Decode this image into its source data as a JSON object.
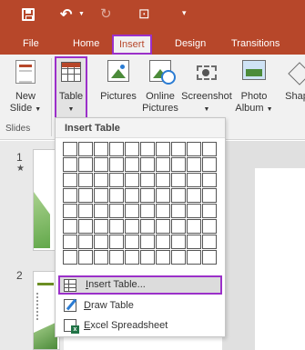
{
  "tabs": {
    "file": "File",
    "home": "Home",
    "insert": "Insert",
    "design": "Design",
    "transitions": "Transitions"
  },
  "ribbon": {
    "new_slide": [
      "New",
      "Slide"
    ],
    "table": "Table",
    "pictures": "Pictures",
    "online_pictures": [
      "Online",
      "Pictures"
    ],
    "screenshot": "Screenshot",
    "photo_album": [
      "Photo",
      "Album"
    ],
    "shapes": "Shap",
    "group_slides": "Slides"
  },
  "slides": {
    "numbers": [
      "1",
      "2"
    ],
    "star": "★"
  },
  "dropdown": {
    "header": "Insert Table",
    "grid": {
      "columns": 10,
      "rows": 8
    },
    "items": {
      "insert_table_accel": "I",
      "insert_table_rest": "nsert Table...",
      "draw_table_accel": "D",
      "draw_table_rest": "raw Table",
      "excel_accel": "E",
      "excel_rest": "xcel Spreadsheet"
    }
  },
  "colors": {
    "brand": "#b7472a",
    "highlight": "#9b30c9"
  },
  "icons": {
    "save": "save-icon",
    "undo": "undo-icon",
    "redo": "redo-icon",
    "present": "start-slideshow-icon",
    "customize": "customize-toolbar-icon"
  }
}
